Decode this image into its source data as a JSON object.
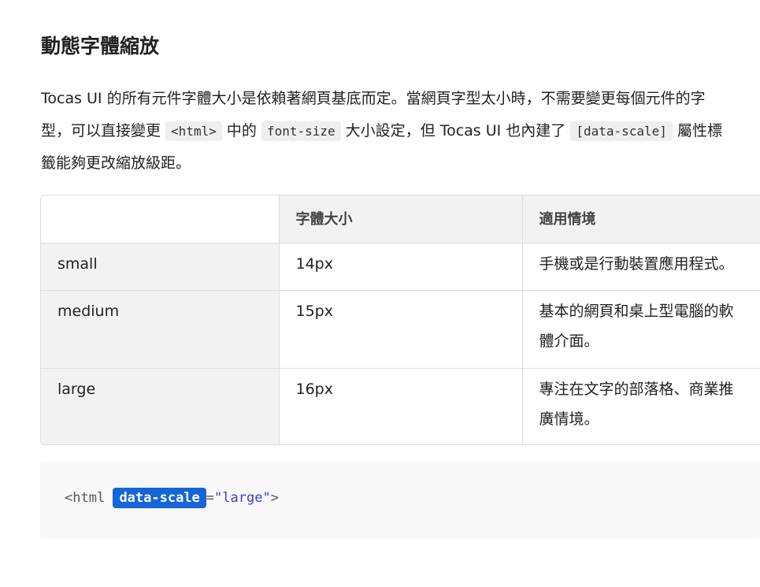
{
  "section": {
    "title": "動態字體縮放"
  },
  "intro": {
    "line1": "Tocas UI 的所有元件字體大小是依賴著網頁基底而定。當網頁字型太小時，不需要變更每個元件的字",
    "line2_a": "型，可以直接變更 ",
    "code_html": "<html>",
    "line2_b": " 中的 ",
    "code_font_size": "font-size",
    "line2_c": " 大小設定，但 Tocas UI 也內建了 ",
    "code_data_scale": "[data-scale]",
    "line2_d": " 屬性標",
    "line3": "籤能夠更改縮放級距。"
  },
  "table": {
    "headers": [
      "",
      "字體大小",
      "適用情境"
    ],
    "rows": [
      {
        "name": "small",
        "size": "14px",
        "usage": "手機或是行動裝置應用程式。"
      },
      {
        "name": "medium",
        "size": "15px",
        "usage_line1": "基本的網頁和桌上型電腦的軟",
        "usage_line2": "體介面。"
      },
      {
        "name": "large",
        "size": "16px",
        "usage_line1": "專注在文字的部落格、商業推",
        "usage_line2": "廣情境。"
      }
    ]
  },
  "code_example": {
    "tag_open": "<html",
    "attr_name": "data-scale",
    "equals": "=",
    "attr_value": "\"large\"",
    "tag_close": ">"
  },
  "colors": {
    "highlight": "#1565d8",
    "header_bg": "#f2f2f2",
    "code_bg": "#f8f8f8"
  }
}
